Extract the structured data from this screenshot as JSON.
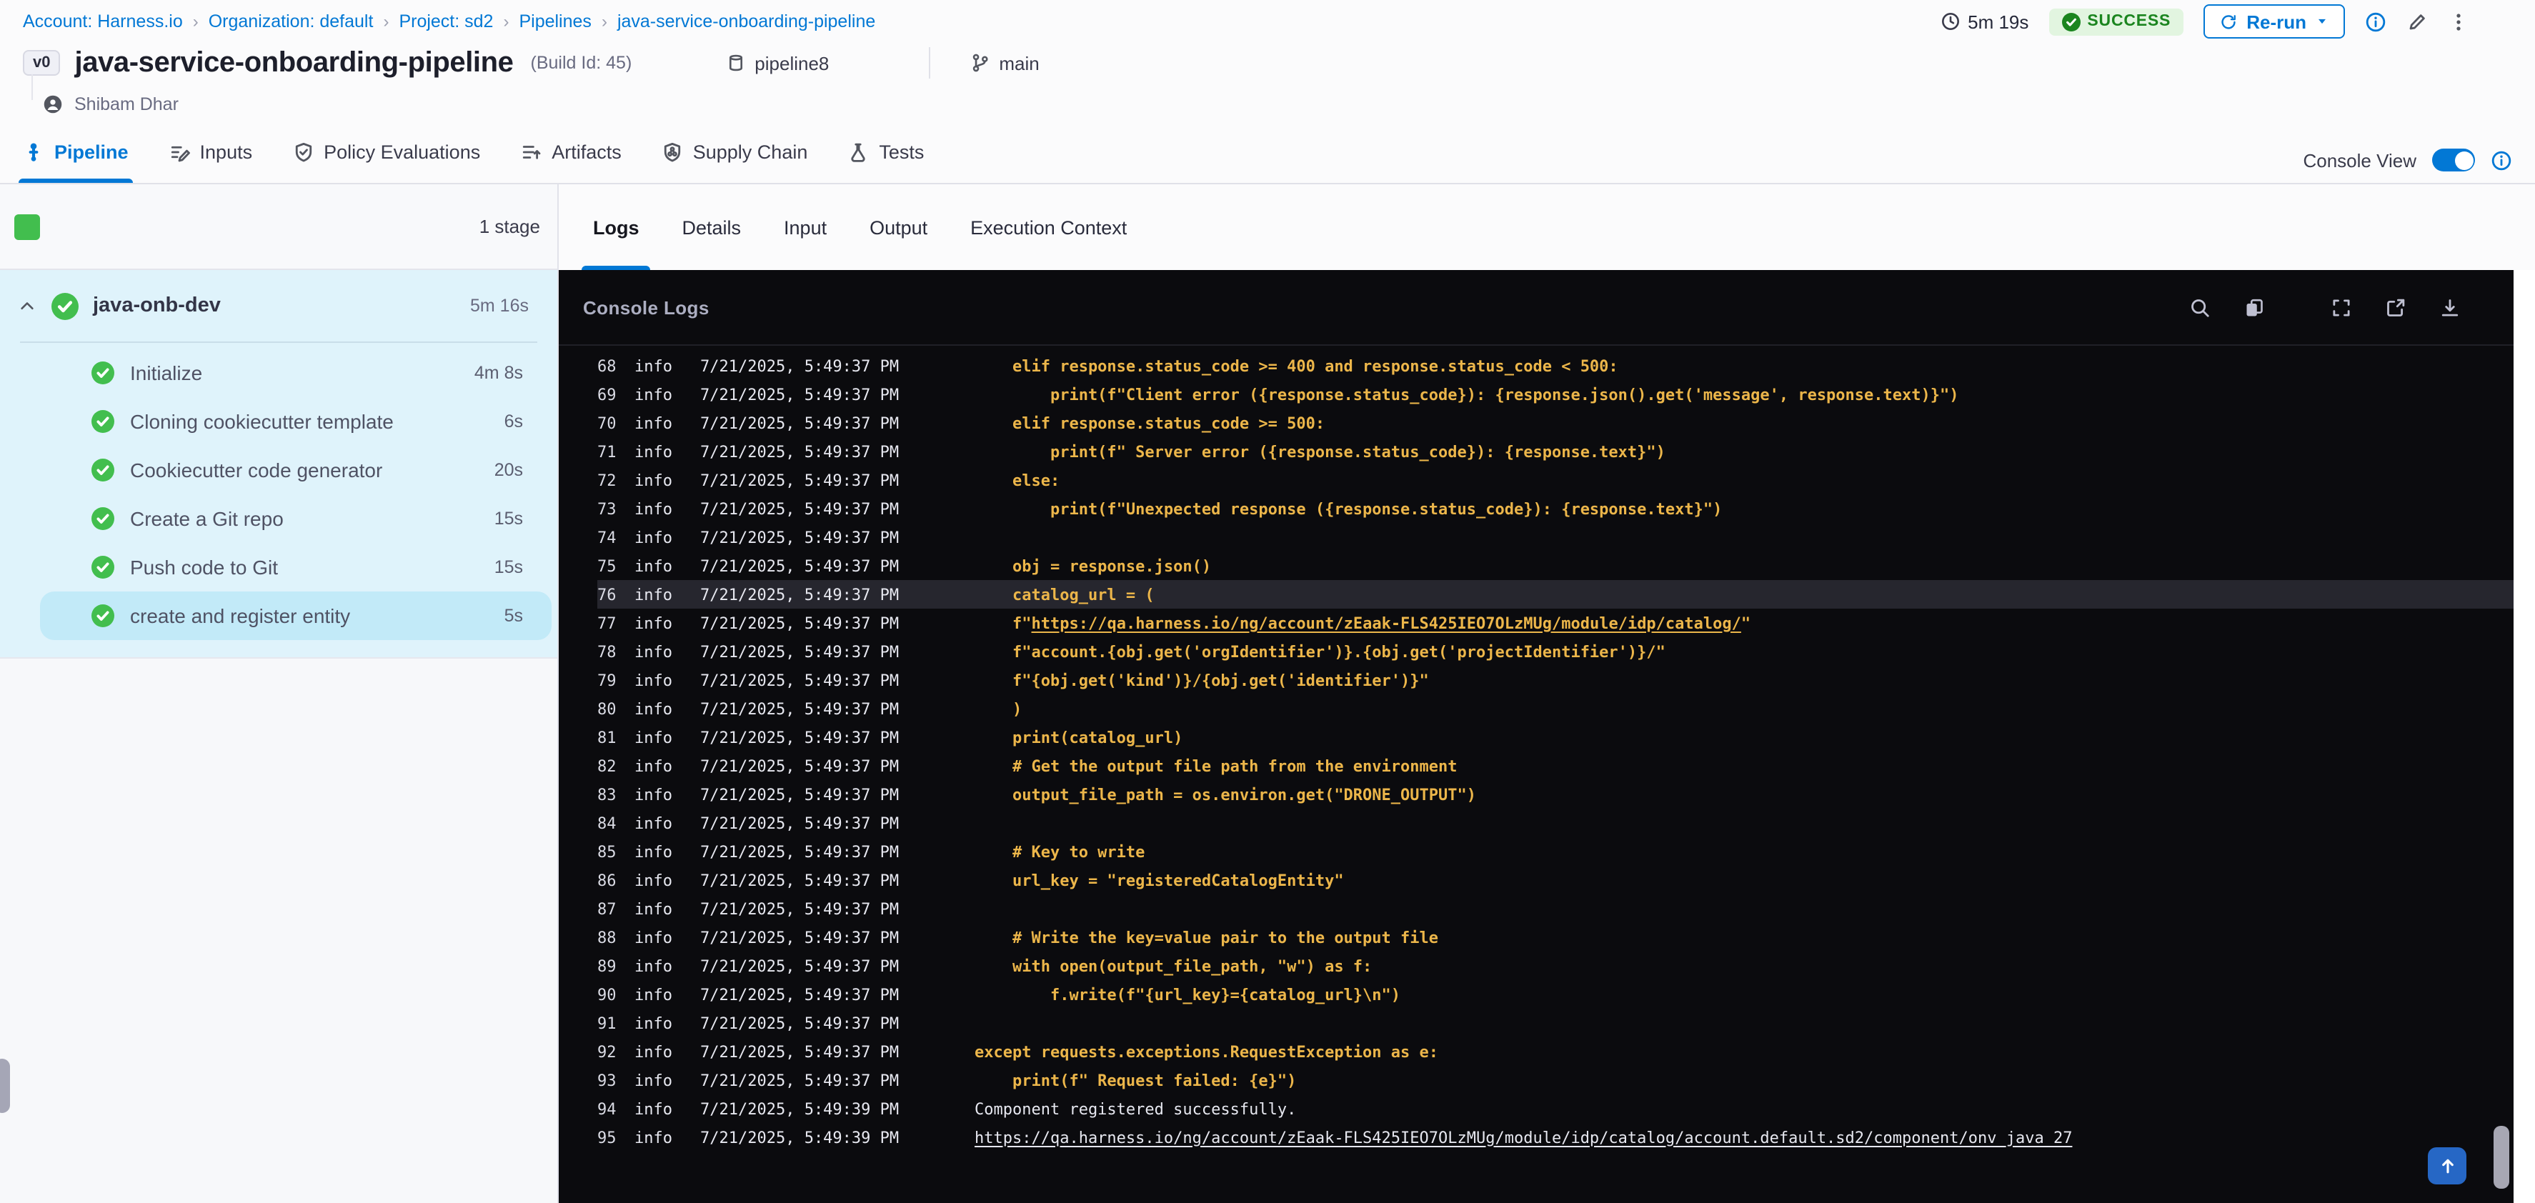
{
  "colors": {
    "accent_blue": "#0278D5",
    "success_green": "#1B851F",
    "step_green": "#42BE4E",
    "console_bg": "#0B0B0E",
    "log_code_yellow": "#ECB64A",
    "log_text_white": "#E7E8F0",
    "sidebar_blue": "#DFF3FB",
    "selected_step_blue": "#C2EAF8"
  },
  "breadcrumb": {
    "items": [
      "Account: Harness.io",
      "Organization: default",
      "Project: sd2",
      "Pipelines",
      "java-service-onboarding-pipeline"
    ]
  },
  "header": {
    "duration": "5m 19s",
    "status": "SUCCESS",
    "rerun_label": "Re-run",
    "version_badge": "v0",
    "title": "java-service-onboarding-pipeline",
    "build_id": "(Build Id: 45)",
    "repo": "pipeline8",
    "branch": "main",
    "owner": "Shibam Dhar"
  },
  "tabs": {
    "items": [
      {
        "label": "Pipeline",
        "icon": "pipeline",
        "active": true
      },
      {
        "label": "Inputs",
        "icon": "inputs",
        "active": false
      },
      {
        "label": "Policy Evaluations",
        "icon": "policy",
        "active": false
      },
      {
        "label": "Artifacts",
        "icon": "artifacts",
        "active": false
      },
      {
        "label": "Supply Chain",
        "icon": "supply",
        "active": false
      },
      {
        "label": "Tests",
        "icon": "tests",
        "active": false
      }
    ],
    "console_view_label": "Console View",
    "console_view_on": true
  },
  "sidebar": {
    "stage_count_label": "1 stage",
    "stage": {
      "name": "java-onb-dev",
      "duration": "5m 16s",
      "status": "success"
    },
    "steps": [
      {
        "label": "Initialize",
        "duration": "4m 8s",
        "selected": false
      },
      {
        "label": "Cloning cookiecutter template",
        "duration": "6s",
        "selected": false
      },
      {
        "label": "Cookiecutter code generator",
        "duration": "20s",
        "selected": false
      },
      {
        "label": "Create a Git repo",
        "duration": "15s",
        "selected": false
      },
      {
        "label": "Push code to Git",
        "duration": "15s",
        "selected": false
      },
      {
        "label": "create and register entity",
        "duration": "5s",
        "selected": true
      }
    ]
  },
  "panel": {
    "tabs": [
      "Logs",
      "Details",
      "Input",
      "Output",
      "Execution Context"
    ],
    "active_tab": "Logs",
    "console_title": "Console Logs",
    "toolbar_icons": [
      "search",
      "copy",
      "settings",
      "fullscreen",
      "open-new",
      "download"
    ]
  },
  "logs": {
    "lines": [
      {
        "n": "68",
        "level": "info",
        "ts": "7/21/2025, 5:49:37 PM",
        "style": "code",
        "parts": [
          {
            "t": "    elif response.status_code >= 400 and response.status_code < 500:"
          }
        ]
      },
      {
        "n": "69",
        "level": "info",
        "ts": "7/21/2025, 5:49:37 PM",
        "style": "code",
        "parts": [
          {
            "t": "        print(f\"Client error ({response.status_code}): {response.json().get('message', response.text)}\")"
          }
        ]
      },
      {
        "n": "70",
        "level": "info",
        "ts": "7/21/2025, 5:49:37 PM",
        "style": "code",
        "parts": [
          {
            "t": "    elif response.status_code >= 500:"
          }
        ]
      },
      {
        "n": "71",
        "level": "info",
        "ts": "7/21/2025, 5:49:37 PM",
        "style": "code",
        "parts": [
          {
            "t": "        print(f\" Server error ({response.status_code}): {response.text}\")"
          }
        ]
      },
      {
        "n": "72",
        "level": "info",
        "ts": "7/21/2025, 5:49:37 PM",
        "style": "code",
        "parts": [
          {
            "t": "    else:"
          }
        ]
      },
      {
        "n": "73",
        "level": "info",
        "ts": "7/21/2025, 5:49:37 PM",
        "style": "code",
        "parts": [
          {
            "t": "        print(f\"Unexpected response ({response.status_code}): {response.text}\")"
          }
        ]
      },
      {
        "n": "74",
        "level": "info",
        "ts": "7/21/2025, 5:49:37 PM",
        "style": "code",
        "parts": []
      },
      {
        "n": "75",
        "level": "info",
        "ts": "7/21/2025, 5:49:37 PM",
        "style": "code",
        "parts": [
          {
            "t": "    obj = response.json()"
          }
        ]
      },
      {
        "n": "76",
        "level": "info",
        "ts": "7/21/2025, 5:49:37 PM",
        "style": "code",
        "highlight": true,
        "parts": [
          {
            "t": "    catalog_url = ("
          }
        ]
      },
      {
        "n": "77",
        "level": "info",
        "ts": "7/21/2025, 5:49:37 PM",
        "style": "code",
        "parts": [
          {
            "t": "    f\""
          },
          {
            "t": "https://qa.harness.io/ng/account/zEaak-FLS425IEO7OLzMUg/module/idp/catalog/",
            "link": true
          },
          {
            "t": "\""
          }
        ]
      },
      {
        "n": "78",
        "level": "info",
        "ts": "7/21/2025, 5:49:37 PM",
        "style": "code",
        "parts": [
          {
            "t": "    f\"account.{obj.get('orgIdentifier')}.{obj.get('projectIdentifier')}/\""
          }
        ]
      },
      {
        "n": "79",
        "level": "info",
        "ts": "7/21/2025, 5:49:37 PM",
        "style": "code",
        "parts": [
          {
            "t": "    f\"{obj.get('kind')}/{obj.get('identifier')}\""
          }
        ]
      },
      {
        "n": "80",
        "level": "info",
        "ts": "7/21/2025, 5:49:37 PM",
        "style": "code",
        "parts": [
          {
            "t": "    )"
          }
        ]
      },
      {
        "n": "81",
        "level": "info",
        "ts": "7/21/2025, 5:49:37 PM",
        "style": "code",
        "parts": [
          {
            "t": "    print(catalog_url)"
          }
        ]
      },
      {
        "n": "82",
        "level": "info",
        "ts": "7/21/2025, 5:49:37 PM",
        "style": "code",
        "parts": [
          {
            "t": "    # Get the output file path from the environment"
          }
        ]
      },
      {
        "n": "83",
        "level": "info",
        "ts": "7/21/2025, 5:49:37 PM",
        "style": "code",
        "parts": [
          {
            "t": "    output_file_path = os.environ.get(\"DRONE_OUTPUT\")"
          }
        ]
      },
      {
        "n": "84",
        "level": "info",
        "ts": "7/21/2025, 5:49:37 PM",
        "style": "code",
        "parts": []
      },
      {
        "n": "85",
        "level": "info",
        "ts": "7/21/2025, 5:49:37 PM",
        "style": "code",
        "parts": [
          {
            "t": "    # Key to write"
          }
        ]
      },
      {
        "n": "86",
        "level": "info",
        "ts": "7/21/2025, 5:49:37 PM",
        "style": "code",
        "parts": [
          {
            "t": "    url_key = \"registeredCatalogEntity\""
          }
        ]
      },
      {
        "n": "87",
        "level": "info",
        "ts": "7/21/2025, 5:49:37 PM",
        "style": "code",
        "parts": []
      },
      {
        "n": "88",
        "level": "info",
        "ts": "7/21/2025, 5:49:37 PM",
        "style": "code",
        "parts": [
          {
            "t": "    # Write the key=value pair to the output file"
          }
        ]
      },
      {
        "n": "89",
        "level": "info",
        "ts": "7/21/2025, 5:49:37 PM",
        "style": "code",
        "parts": [
          {
            "t": "    with open(output_file_path, \"w\") as f:"
          }
        ]
      },
      {
        "n": "90",
        "level": "info",
        "ts": "7/21/2025, 5:49:37 PM",
        "style": "code",
        "parts": [
          {
            "t": "        f.write(f\"{url_key}={catalog_url}\\n\")"
          }
        ]
      },
      {
        "n": "91",
        "level": "info",
        "ts": "7/21/2025, 5:49:37 PM",
        "style": "code",
        "parts": []
      },
      {
        "n": "92",
        "level": "info",
        "ts": "7/21/2025, 5:49:37 PM",
        "style": "code",
        "parts": [
          {
            "t": "except requests.exceptions.RequestException as e:"
          }
        ]
      },
      {
        "n": "93",
        "level": "info",
        "ts": "7/21/2025, 5:49:37 PM",
        "style": "code",
        "parts": [
          {
            "t": "    print(f\" Request failed: {e}\")"
          }
        ]
      },
      {
        "n": "94",
        "level": "info",
        "ts": "7/21/2025, 5:49:39 PM",
        "style": "plain",
        "parts": [
          {
            "t": "Component registered successfully."
          }
        ]
      },
      {
        "n": "95",
        "level": "info",
        "ts": "7/21/2025, 5:49:39 PM",
        "style": "plain",
        "parts": [
          {
            "t": "https://qa.harness.io/ng/account/zEaak-FLS425IEO7OLzMUg/module/idp/catalog/account.default.sd2/component/onv_java_27",
            "link": true
          }
        ]
      }
    ]
  }
}
